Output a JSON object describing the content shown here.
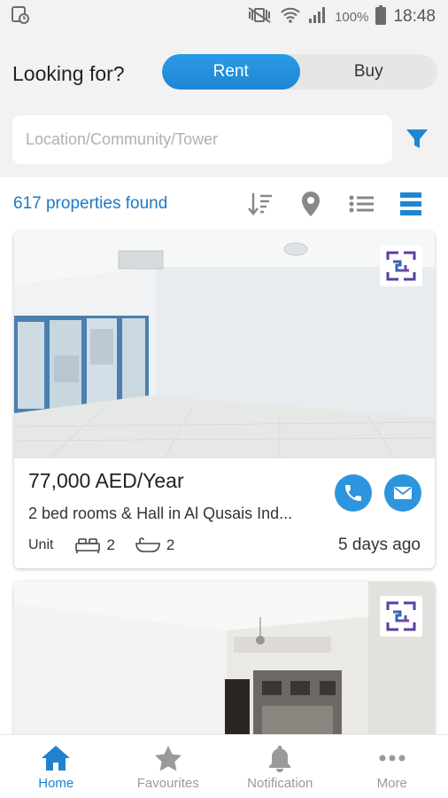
{
  "status_bar": {
    "battery_percent": "100%",
    "time": "18:48"
  },
  "header": {
    "looking_for_label": "Looking for?",
    "mode_options": [
      {
        "label": "Rent",
        "selected": true
      },
      {
        "label": "Buy",
        "selected": false
      }
    ],
    "search": {
      "placeholder": "Location/Community/Tower",
      "value": ""
    }
  },
  "results": {
    "count_text": "617 properties found"
  },
  "listings": [
    {
      "price": "77,000 AED/Year",
      "title": "2 bed rooms & Hall in Al Qusais Ind...",
      "type": "Unit",
      "bedrooms": "2",
      "bathrooms": "2",
      "posted": "5 days ago"
    },
    {
      "price": "",
      "title": "",
      "type": "",
      "bedrooms": "",
      "bathrooms": "",
      "posted": ""
    }
  ],
  "bottom_nav": [
    {
      "label": "Home",
      "icon": "home-icon",
      "active": true
    },
    {
      "label": "Favourites",
      "icon": "star-icon",
      "active": false
    },
    {
      "label": "Notification",
      "icon": "bell-icon",
      "active": false
    },
    {
      "label": "More",
      "icon": "more-dots-icon",
      "active": false
    }
  ],
  "colors": {
    "accent": "#1f86d2",
    "link_blue": "#1e78c8",
    "inactive": "#9a9a9a"
  }
}
